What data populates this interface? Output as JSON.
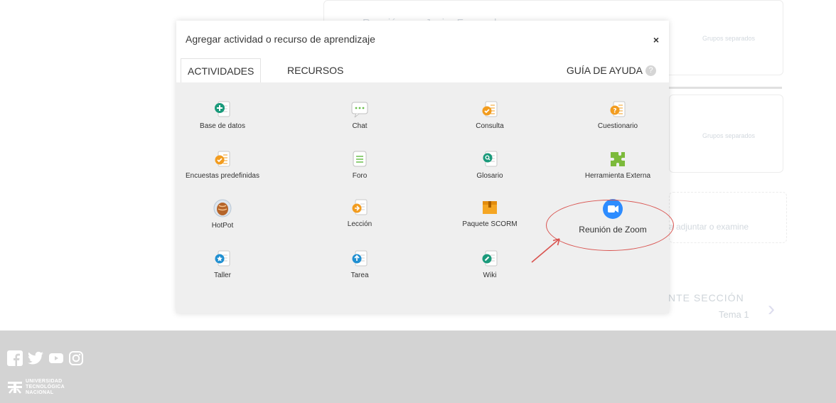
{
  "modal": {
    "title": "Agregar actividad o recurso de aprendizaje",
    "close": "×",
    "tabs": [
      "ACTIVIDADES",
      "RECURSOS"
    ],
    "help": "GUÍA DE AYUDA",
    "help_icon": "?"
  },
  "activities": [
    {
      "label": "Base de datos",
      "icon": "database-icon",
      "color": "#1a9a7b"
    },
    {
      "label": "Chat",
      "icon": "chat-icon",
      "color": "#6bbf4e"
    },
    {
      "label": "Consulta",
      "icon": "choice-icon",
      "color": "#f29c1f"
    },
    {
      "label": "Cuestionario",
      "icon": "quiz-icon",
      "color": "#f29c1f"
    },
    {
      "label": "Encuestas predefinidas",
      "icon": "survey-icon",
      "color": "#f29c1f"
    },
    {
      "label": "Foro",
      "icon": "forum-icon",
      "color": "#6bbf4e"
    },
    {
      "label": "Glosario",
      "icon": "glossary-icon",
      "color": "#1a9a7b"
    },
    {
      "label": "Herramienta Externa",
      "icon": "puzzle-icon",
      "color": "#7cba3b"
    },
    {
      "label": "HotPot",
      "icon": "hotpot-icon",
      "color": "#b5652a"
    },
    {
      "label": "Lección",
      "icon": "lesson-icon",
      "color": "#f29c1f"
    },
    {
      "label": "Paquete SCORM",
      "icon": "scorm-icon",
      "color": "#f5a623"
    },
    {
      "label": "Reunión de Zoom",
      "icon": "zoom-icon",
      "color": "#2d8cff"
    },
    {
      "label": "Taller",
      "icon": "workshop-icon",
      "color": "#1f8fd1"
    },
    {
      "label": "Tarea",
      "icon": "assignment-icon",
      "color": "#1f8fd1"
    },
    {
      "label": "Wiki",
      "icon": "wiki-icon",
      "color": "#1a9a7b"
    }
  ],
  "background": {
    "meeting": "Reunión con Javier Fernandez",
    "groups1": "Grupos separados",
    "groups2": "Grupos separados",
    "upload": "a adjuntar o examine",
    "next": "NTE SECCIÓN",
    "next_topic": "Tema 1"
  },
  "footer": {
    "university_line1": "UNIVERSIDAD",
    "university_line2": "TECNOLÓGICA",
    "university_line3": "NACIONAL"
  }
}
